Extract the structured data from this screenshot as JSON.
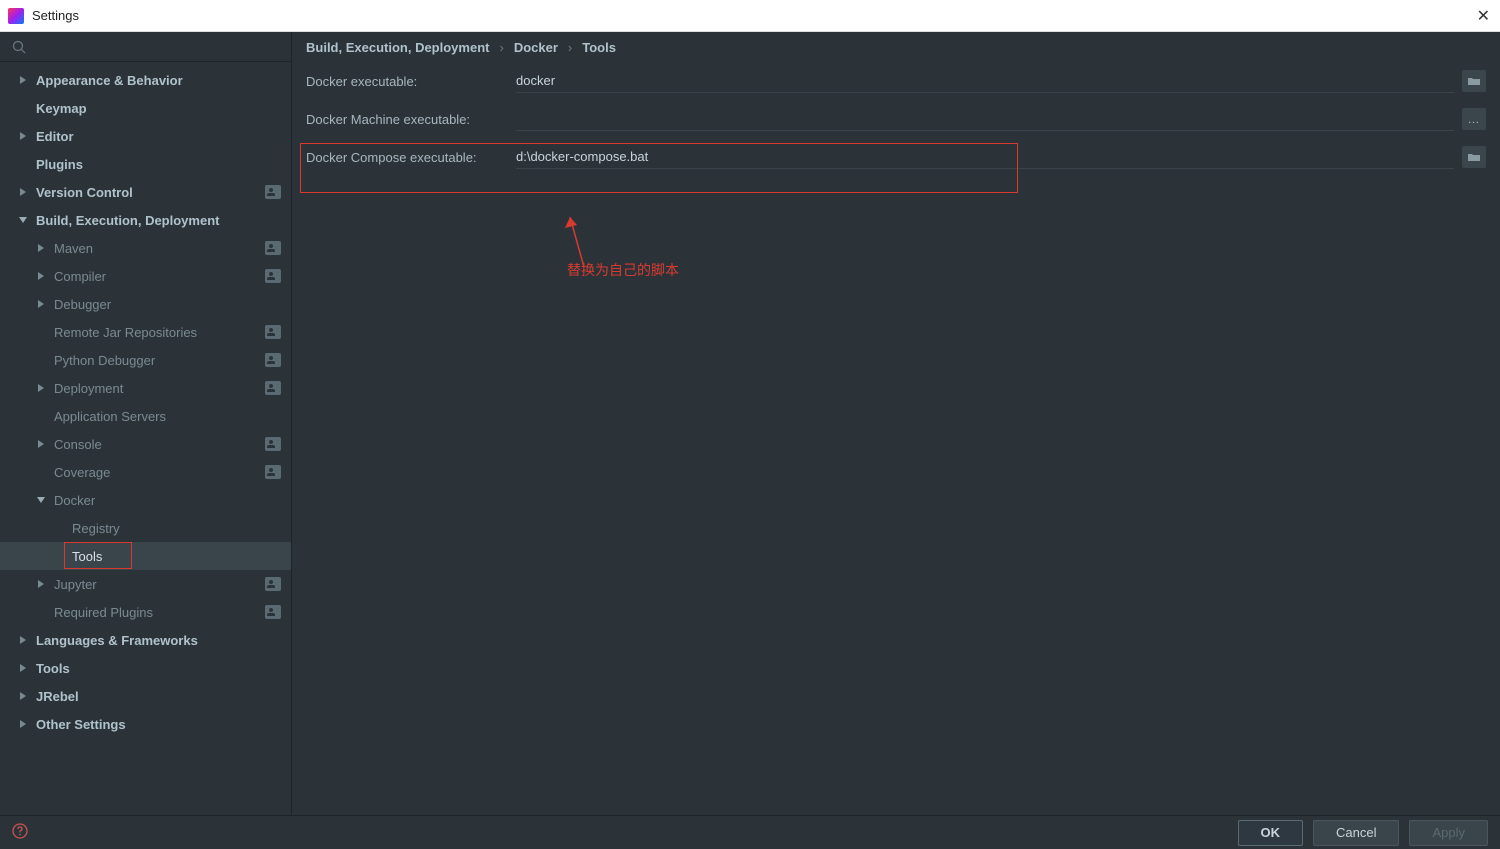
{
  "window": {
    "title": "Settings"
  },
  "breadcrumb": [
    "Build, Execution, Deployment",
    "Docker",
    "Tools"
  ],
  "form": {
    "docker_exec_label": "Docker executable:",
    "docker_exec_value": "docker",
    "docker_machine_label": "Docker Machine executable:",
    "docker_machine_value": "",
    "docker_compose_label": "Docker Compose executable:",
    "docker_compose_value": "d:\\docker-compose.bat"
  },
  "annotation": {
    "text": "替换为自己的脚本"
  },
  "sidebar": {
    "items": [
      {
        "label": "Appearance & Behavior",
        "depth": 0,
        "arrow": "right",
        "bold": true
      },
      {
        "label": "Keymap",
        "depth": 0,
        "arrow": "",
        "bold": true
      },
      {
        "label": "Editor",
        "depth": 0,
        "arrow": "right",
        "bold": true
      },
      {
        "label": "Plugins",
        "depth": 0,
        "arrow": "",
        "bold": true
      },
      {
        "label": "Version Control",
        "depth": 0,
        "arrow": "right",
        "bold": true,
        "badge": true
      },
      {
        "label": "Build, Execution, Deployment",
        "depth": 0,
        "arrow": "down",
        "bold": true
      },
      {
        "label": "Maven",
        "depth": 1,
        "arrow": "right",
        "badge": true
      },
      {
        "label": "Compiler",
        "depth": 1,
        "arrow": "right",
        "badge": true
      },
      {
        "label": "Debugger",
        "depth": 1,
        "arrow": "right"
      },
      {
        "label": "Remote Jar Repositories",
        "depth": 1,
        "arrow": "",
        "badge": true
      },
      {
        "label": "Python Debugger",
        "depth": 1,
        "arrow": "",
        "badge": true
      },
      {
        "label": "Deployment",
        "depth": 1,
        "arrow": "right",
        "badge": true
      },
      {
        "label": "Application Servers",
        "depth": 1,
        "arrow": ""
      },
      {
        "label": "Console",
        "depth": 1,
        "arrow": "right",
        "badge": true
      },
      {
        "label": "Coverage",
        "depth": 1,
        "arrow": "",
        "badge": true
      },
      {
        "label": "Docker",
        "depth": 1,
        "arrow": "down"
      },
      {
        "label": "Registry",
        "depth": 2,
        "arrow": ""
      },
      {
        "label": "Tools",
        "depth": 2,
        "arrow": "",
        "selected": true,
        "redbox": true
      },
      {
        "label": "Jupyter",
        "depth": 1,
        "arrow": "right",
        "badge": true
      },
      {
        "label": "Required Plugins",
        "depth": 1,
        "arrow": "",
        "badge": true
      },
      {
        "label": "Languages & Frameworks",
        "depth": 0,
        "arrow": "right",
        "bold": true
      },
      {
        "label": "Tools",
        "depth": 0,
        "arrow": "right",
        "bold": true
      },
      {
        "label": "JRebel",
        "depth": 0,
        "arrow": "right",
        "bold": true
      },
      {
        "label": "Other Settings",
        "depth": 0,
        "arrow": "right",
        "bold": true
      }
    ]
  },
  "buttons": {
    "ok": "OK",
    "cancel": "Cancel",
    "apply": "Apply"
  }
}
